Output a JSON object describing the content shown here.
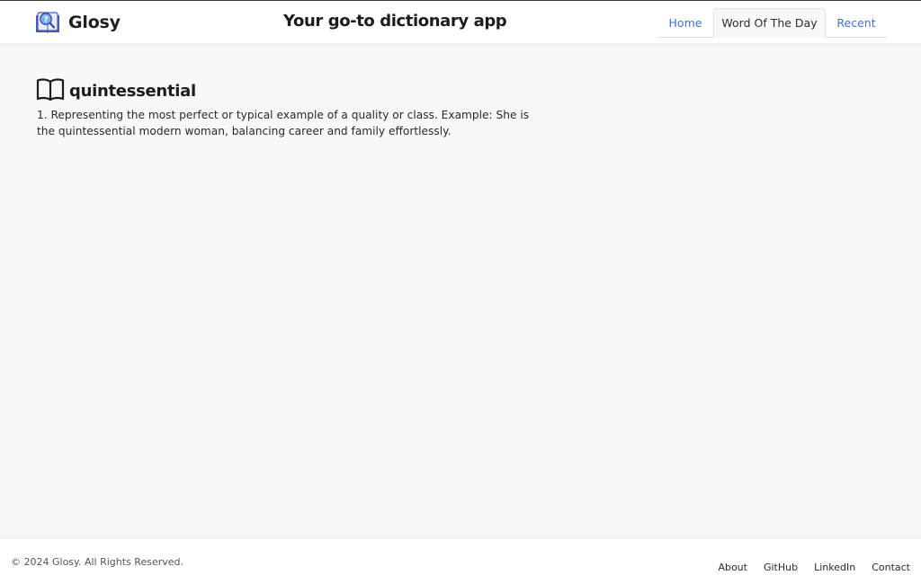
{
  "header": {
    "brand_name": "Glosy",
    "tagline": "Your go-to dictionary app",
    "logo_icon": "book-question-logo-icon"
  },
  "nav": {
    "tabs": [
      {
        "label": "Home",
        "active": false
      },
      {
        "label": "Word Of The Day",
        "active": true
      },
      {
        "label": "Recent",
        "active": false
      }
    ]
  },
  "word": {
    "icon": "open-book-icon",
    "title": "quintessential",
    "definition": "1. Representing the most perfect or typical example of a quality or class. Example: She is the quintessential modern woman, balancing career and family effortlessly."
  },
  "footer": {
    "copyright": "© 2024 Glosy. All Rights Reserved.",
    "links": [
      "About",
      "GitHub",
      "LinkedIn",
      "Contact"
    ]
  },
  "colors": {
    "accent": "#3f72d8",
    "background": "#f7f8fa",
    "surface": "#ffffff",
    "text": "#212529"
  }
}
